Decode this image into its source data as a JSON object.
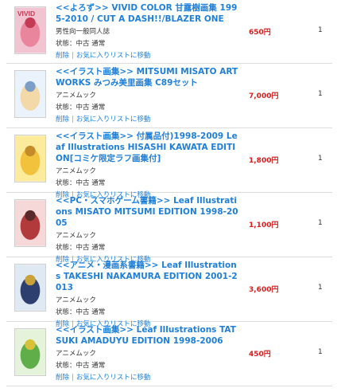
{
  "items": [
    {
      "title": "<<よろず>> VIVID COLOR 甘露樹画集 1995-2010 / CUT A DASH!!/BLAZER ONE",
      "maker": "男性向一般同人誌",
      "condition": "状態：中古 通常",
      "delete_label": "削除",
      "favorite_label": "お気に入りリストに移動",
      "price": "650円",
      "qty": "1",
      "cover_colors": [
        "#f2c4d2",
        "#e9869e",
        "#c43a55"
      ],
      "cover_text": "VIVID"
    },
    {
      "title": "<<イラスト画集>> MITSUMI MISATO ART WORKS みつみ美里画集 C89セット",
      "maker": "アニメムック",
      "condition": "状態：中古 通常",
      "delete_label": "削除",
      "favorite_label": "お気に入りリストに移動",
      "price": "7,000円",
      "qty": "1",
      "cover_colors": [
        "#eaf2fb",
        "#f4d9a8",
        "#7d9fc7"
      ],
      "cover_text": ""
    },
    {
      "title": "<<イラスト画集>> 付属品付)1998-2009 Leaf Illustrations HISASHI KAWATA EDITION[コミケ限定ラフ画集付]",
      "maker": "アニメムック",
      "condition": "状態：中古 通常",
      "delete_label": "削除",
      "favorite_label": "お気に入りリストに移動",
      "price": "1,800円",
      "qty": "1",
      "cover_colors": [
        "#fbeb9a",
        "#f2c23c",
        "#c58b2a"
      ],
      "cover_text": ""
    },
    {
      "title": "<<PC・スマホゲーム書籍>> Leaf Illustrations MISATO MITSUMI EDITION 1998-2005",
      "maker": "アニメムック",
      "condition": "状態：中古 通常",
      "delete_label": "削除",
      "favorite_label": "お気に入りリストに移動",
      "price": "1,100円",
      "qty": "1",
      "cover_colors": [
        "#f6d8d8",
        "#b23a3a",
        "#5a2a2a"
      ],
      "cover_text": ""
    },
    {
      "title": "<<アニメ・漫画系書籍>> Leaf Illustrations TAKESHI NAKAMURA EDITION 2001-2013",
      "maker": "アニメムック",
      "condition": "状態：中古 通常",
      "delete_label": "削除",
      "favorite_label": "お気に入りリストに移動",
      "price": "3,600円",
      "qty": "1",
      "cover_colors": [
        "#dfe9f4",
        "#2d3f6e",
        "#c9a33a"
      ],
      "cover_text": ""
    },
    {
      "title": "<<イラスト画集>> Leaf Illustrations TATSUKI AMADUYU EDITION 1998-2006",
      "maker": "アニメムック",
      "condition": "状態：中古 通常",
      "delete_label": "削除",
      "favorite_label": "お気に入りリストに移動",
      "price": "450円",
      "qty": "1",
      "cover_colors": [
        "#e4f3d9",
        "#5fae4a",
        "#d8c23a"
      ],
      "cover_text": ""
    }
  ]
}
